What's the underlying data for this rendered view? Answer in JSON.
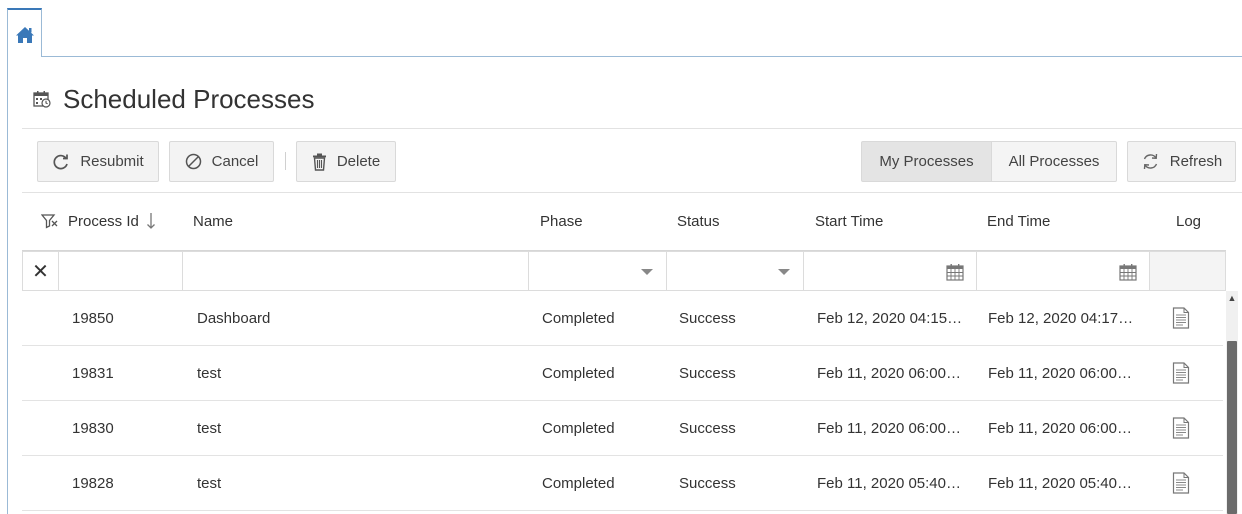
{
  "header": {
    "title": "Scheduled Processes"
  },
  "toolbar": {
    "resubmit_label": "Resubmit",
    "cancel_label": "Cancel",
    "delete_label": "Delete",
    "my_processes_label": "My Processes",
    "all_processes_label": "All Processes",
    "refresh_label": "Refresh"
  },
  "columns": {
    "process_id": "Process Id",
    "name": "Name",
    "phase": "Phase",
    "status": "Status",
    "start_time": "Start Time",
    "end_time": "End Time",
    "log": "Log"
  },
  "filters": {
    "clear_symbol": "✕"
  },
  "rows": [
    {
      "id": "19850",
      "name": "Dashboard",
      "phase": "Completed",
      "status": "Success",
      "start": "Feb 12, 2020 04:15…",
      "end": "Feb 12, 2020 04:17…"
    },
    {
      "id": "19831",
      "name": "test",
      "phase": "Completed",
      "status": "Success",
      "start": "Feb 11, 2020 06:00…",
      "end": "Feb 11, 2020 06:00…"
    },
    {
      "id": "19830",
      "name": "test",
      "phase": "Completed",
      "status": "Success",
      "start": "Feb 11, 2020 06:00…",
      "end": "Feb 11, 2020 06:00…"
    },
    {
      "id": "19828",
      "name": "test",
      "phase": "Completed",
      "status": "Success",
      "start": "Feb 11, 2020 05:40…",
      "end": "Feb 11, 2020 05:40…"
    }
  ],
  "colors": {
    "accent": "#3a78b8",
    "border": "#9bbad6"
  },
  "icons": {
    "home": "home-icon",
    "calendar": "calendar-icon",
    "resubmit": "refresh-arrow-icon",
    "cancel": "cancel-circle-icon",
    "delete": "trash-icon",
    "refresh": "refresh-icon",
    "filter": "filter-icon",
    "sort": "sort-down-icon",
    "log": "log-document-icon"
  }
}
